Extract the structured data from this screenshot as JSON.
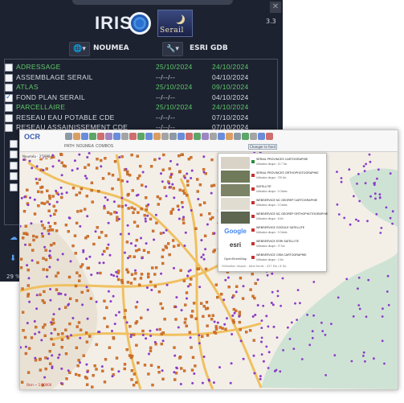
{
  "app": {
    "version": "3.3",
    "logo_text": "IRIS",
    "partner_logo_text": "Serail"
  },
  "selectors": {
    "commune": "NOUMEA",
    "database": "ESRI GDB"
  },
  "layers_list": [
    {
      "label": "ADRESSAGE",
      "date1": "25/10/2024",
      "date2": "24/10/2024",
      "checked": false,
      "highlight": true
    },
    {
      "label": "ASSEMBLAGE SERAIL",
      "date1": "--/--/--",
      "date2": "04/10/2024",
      "checked": false,
      "highlight": false
    },
    {
      "label": "ATLAS",
      "date1": "25/10/2024",
      "date2": "09/10/2024",
      "checked": false,
      "highlight": true
    },
    {
      "label": "FOND PLAN SERAIL",
      "date1": "--/--/--",
      "date2": "04/10/2024",
      "checked": true,
      "highlight": false
    },
    {
      "label": "PARCELLAIRE",
      "date1": "25/10/2024",
      "date2": "24/10/2024",
      "checked": false,
      "highlight": true
    },
    {
      "label": "RESEAU EAU POTABLE CDE",
      "date1": "--/--/--",
      "date2": "07/10/2024",
      "checked": false,
      "highlight": false
    },
    {
      "label": "RESEAU ASSAINISSEMENT CDE",
      "date1": "--/--/--",
      "date2": "07/10/2024",
      "checked": false,
      "highlight": false
    }
  ],
  "progress": {
    "label": "29 %",
    "value": 0.29
  },
  "map_window": {
    "brand": "OCR",
    "tabs": [
      "PATH",
      "NOUMEA",
      "COMBOS"
    ],
    "coords": "Nouméa - 2'5998",
    "scale": "0km ~ 1:10000",
    "change_button": "Changer le fond",
    "basemaps": [
      {
        "title": "SERAIL PROVINCES CARTOGRAPHIE",
        "sub": "Utilisation disque : 10.7 Mo",
        "thumb": "#d9d3c7"
      },
      {
        "title": "SERAIL PROVINCES ORTHOPHOTOGRAPHIE",
        "sub": "Utilisation disque : 739 Mo",
        "thumb": "#6f7a5a"
      },
      {
        "title": "SATELLITE",
        "sub": "Utilisation disque : 0 Octets",
        "thumb": "#7c8367"
      },
      {
        "title": "WEBSERVICE NC GEOREP CARTOGRAPHIE",
        "sub": "Utilisation disque : 0 Octets",
        "thumb": "#e0dcd0"
      },
      {
        "title": "WEBSERVICE NC GEOREP ORTHOPHOTOGRAPHIE",
        "sub": "Utilisation disque : 6 Mo",
        "thumb": "#5e6650"
      },
      {
        "title": "WEBSERVICE GOOGLE SATELLITE",
        "sub": "Utilisation disque : 0 Octets",
        "thumb": "google"
      },
      {
        "title": "WEBSERVICE ESRI SATELLITE",
        "sub": "Utilisation disque : 27 Mo",
        "thumb": "esri"
      },
      {
        "title": "WEBSERVICE OSM CARTOGRAPHIE",
        "sub": "Utilisation disque : 1 Mo",
        "thumb": "osm"
      }
    ],
    "basemap_footer": "Utilisation disque - total fonds : 257 Mo / 8 Go",
    "thumb_labels": {
      "google": "Google",
      "esri": "esri",
      "osm": "OpenStreetMap"
    }
  }
}
